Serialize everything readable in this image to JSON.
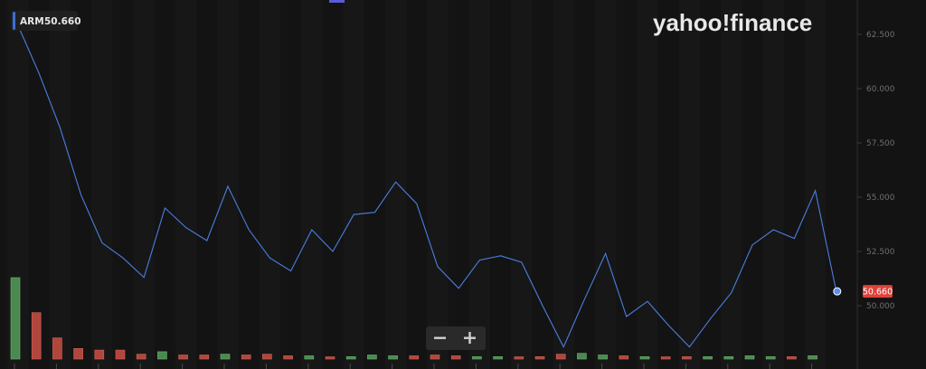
{
  "brand": {
    "logo_text": "yahoo!finance"
  },
  "legend": {
    "symbol": "ARM",
    "value": "50.660",
    "color": "#3b6fd4"
  },
  "zoom": {
    "minus_label": "−",
    "plus_label": "+"
  },
  "last_price": {
    "label": "50.660",
    "value": 50.66,
    "color": "#e0423a"
  },
  "colors": {
    "line": "#4a7fe0",
    "up": "#4a8a4f",
    "down": "#b0463c",
    "background": "#131313"
  },
  "chart_data": {
    "type": "line",
    "title": "",
    "xlabel": "",
    "ylabel": "",
    "ylim": [
      47.9,
      64.3
    ],
    "yticks": [
      "62.500",
      "60.000",
      "57.500",
      "55.000",
      "52.500",
      "50.000"
    ],
    "grid": false,
    "series": [
      {
        "name": "ARM",
        "values": [
          62.9,
          60.7,
          58.2,
          55.1,
          52.9,
          52.2,
          51.3,
          54.5,
          53.6,
          53.0,
          55.5,
          53.5,
          52.2,
          51.6,
          53.5,
          52.5,
          54.2,
          54.3,
          55.7,
          54.7,
          51.8,
          50.8,
          52.1,
          52.3,
          52.0,
          50.0,
          48.1,
          50.3,
          52.4,
          49.5,
          50.2,
          49.1,
          48.1,
          49.4,
          50.6,
          52.8,
          53.5,
          53.1,
          55.3,
          50.66
        ]
      }
    ],
    "volume": {
      "values": [
        1.0,
        0.57,
        0.26,
        0.13,
        0.11,
        0.11,
        0.06,
        0.09,
        0.05,
        0.05,
        0.06,
        0.05,
        0.06,
        0.04,
        0.04,
        0.02,
        0.03,
        0.05,
        0.04,
        0.04,
        0.05,
        0.04,
        0.03,
        0.03,
        0.02,
        0.03,
        0.06,
        0.07,
        0.05,
        0.04,
        0.03,
        0.02,
        0.03,
        0.03,
        0.03,
        0.04,
        0.03,
        0.03,
        0.04
      ],
      "direction": [
        "up",
        "down",
        "down",
        "down",
        "down",
        "down",
        "down",
        "up",
        "down",
        "down",
        "up",
        "down",
        "down",
        "down",
        "up",
        "down",
        "up",
        "up",
        "up",
        "down",
        "down",
        "down",
        "up",
        "up",
        "down",
        "down",
        "down",
        "up",
        "up",
        "down",
        "up",
        "down",
        "down",
        "up",
        "up",
        "up",
        "up",
        "down",
        "up"
      ]
    }
  }
}
